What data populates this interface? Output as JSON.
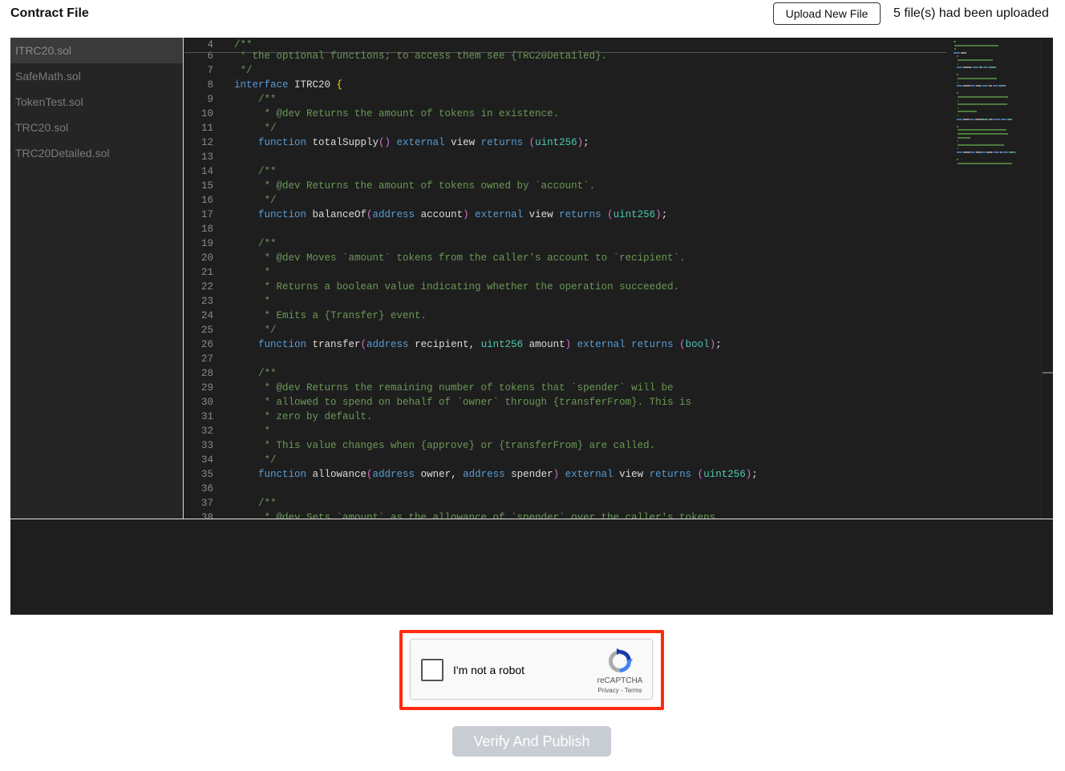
{
  "header": {
    "title": "Contract File",
    "upload_button": "Upload New File",
    "upload_status": "5 file(s) had been uploaded"
  },
  "files": [
    {
      "name": "ITRC20.sol",
      "active": true
    },
    {
      "name": "SafeMath.sol",
      "active": false
    },
    {
      "name": "TokenTest.sol",
      "active": false
    },
    {
      "name": "TRC20.sol",
      "active": false
    },
    {
      "name": "TRC20Detailed.sol",
      "active": false
    }
  ],
  "code": [
    {
      "n": "4",
      "t": [
        [
          "c-cm",
          "/**"
        ]
      ]
    },
    {
      "n": "6",
      "t": [
        [
          "c-cm",
          " * the optional functions; to access them see {TRC20Detailed}."
        ]
      ]
    },
    {
      "n": "7",
      "t": [
        [
          "c-cm",
          " */"
        ]
      ]
    },
    {
      "n": "8",
      "t": [
        [
          "c-kw",
          "interface"
        ],
        [
          "c-id",
          " ITRC20 "
        ],
        [
          "c-br",
          "{"
        ]
      ]
    },
    {
      "n": "9",
      "t": [
        [
          "c-cm",
          "    /**"
        ]
      ]
    },
    {
      "n": "10",
      "t": [
        [
          "c-cm",
          "     * @dev Returns the amount of tokens in existence."
        ]
      ]
    },
    {
      "n": "11",
      "t": [
        [
          "c-cm",
          "     */"
        ]
      ]
    },
    {
      "n": "12",
      "t": [
        [
          "c-kw",
          "    function"
        ],
        [
          "c-id",
          " totalSupply"
        ],
        [
          "c-pa",
          "()"
        ],
        [
          "c-kw",
          " external"
        ],
        [
          "c-id",
          " view"
        ],
        [
          "c-kw",
          " returns"
        ],
        [
          "c-pa",
          " ("
        ],
        [
          "c-ty",
          "uint256"
        ],
        [
          "c-pa",
          ")"
        ],
        [
          "c-id",
          ";"
        ]
      ]
    },
    {
      "n": "13",
      "t": []
    },
    {
      "n": "14",
      "t": [
        [
          "c-cm",
          "    /**"
        ]
      ]
    },
    {
      "n": "15",
      "t": [
        [
          "c-cm",
          "     * @dev Returns the amount of tokens owned by `account`."
        ]
      ]
    },
    {
      "n": "16",
      "t": [
        [
          "c-cm",
          "     */"
        ]
      ]
    },
    {
      "n": "17",
      "t": [
        [
          "c-kw",
          "    function"
        ],
        [
          "c-id",
          " balanceOf"
        ],
        [
          "c-pa",
          "("
        ],
        [
          "c-kw",
          "address"
        ],
        [
          "c-id",
          " account"
        ],
        [
          "c-pa",
          ")"
        ],
        [
          "c-kw",
          " external"
        ],
        [
          "c-id",
          " view"
        ],
        [
          "c-kw",
          " returns"
        ],
        [
          "c-pa",
          " ("
        ],
        [
          "c-ty",
          "uint256"
        ],
        [
          "c-pa",
          ")"
        ],
        [
          "c-id",
          ";"
        ]
      ]
    },
    {
      "n": "18",
      "t": []
    },
    {
      "n": "19",
      "t": [
        [
          "c-cm",
          "    /**"
        ]
      ]
    },
    {
      "n": "20",
      "t": [
        [
          "c-cm",
          "     * @dev Moves `amount` tokens from the caller's account to `recipient`."
        ]
      ]
    },
    {
      "n": "21",
      "t": [
        [
          "c-cm",
          "     *"
        ]
      ]
    },
    {
      "n": "22",
      "t": [
        [
          "c-cm",
          "     * Returns a boolean value indicating whether the operation succeeded."
        ]
      ]
    },
    {
      "n": "23",
      "t": [
        [
          "c-cm",
          "     *"
        ]
      ]
    },
    {
      "n": "24",
      "t": [
        [
          "c-cm",
          "     * Emits a {Transfer} event."
        ]
      ]
    },
    {
      "n": "25",
      "t": [
        [
          "c-cm",
          "     */"
        ]
      ]
    },
    {
      "n": "26",
      "t": [
        [
          "c-kw",
          "    function"
        ],
        [
          "c-id",
          " transfer"
        ],
        [
          "c-pa",
          "("
        ],
        [
          "c-kw",
          "address"
        ],
        [
          "c-id",
          " recipient, "
        ],
        [
          "c-ty",
          "uint256"
        ],
        [
          "c-id",
          " amount"
        ],
        [
          "c-pa",
          ")"
        ],
        [
          "c-kw",
          " external"
        ],
        [
          "c-kw",
          " returns"
        ],
        [
          "c-pa",
          " ("
        ],
        [
          "c-ty",
          "bool"
        ],
        [
          "c-pa",
          ")"
        ],
        [
          "c-id",
          ";"
        ]
      ]
    },
    {
      "n": "27",
      "t": []
    },
    {
      "n": "28",
      "t": [
        [
          "c-cm",
          "    /**"
        ]
      ]
    },
    {
      "n": "29",
      "t": [
        [
          "c-cm",
          "     * @dev Returns the remaining number of tokens that `spender` will be"
        ]
      ]
    },
    {
      "n": "30",
      "t": [
        [
          "c-cm",
          "     * allowed to spend on behalf of `owner` through {transferFrom}. This is"
        ]
      ]
    },
    {
      "n": "31",
      "t": [
        [
          "c-cm",
          "     * zero by default."
        ]
      ]
    },
    {
      "n": "32",
      "t": [
        [
          "c-cm",
          "     *"
        ]
      ]
    },
    {
      "n": "33",
      "t": [
        [
          "c-cm",
          "     * This value changes when {approve} or {transferFrom} are called."
        ]
      ]
    },
    {
      "n": "34",
      "t": [
        [
          "c-cm",
          "     */"
        ]
      ]
    },
    {
      "n": "35",
      "t": [
        [
          "c-kw",
          "    function"
        ],
        [
          "c-id",
          " allowance"
        ],
        [
          "c-pa",
          "("
        ],
        [
          "c-kw",
          "address"
        ],
        [
          "c-id",
          " owner, "
        ],
        [
          "c-kw",
          "address"
        ],
        [
          "c-id",
          " spender"
        ],
        [
          "c-pa",
          ")"
        ],
        [
          "c-kw",
          " external"
        ],
        [
          "c-id",
          " view"
        ],
        [
          "c-kw",
          " returns"
        ],
        [
          "c-pa",
          " ("
        ],
        [
          "c-ty",
          "uint256"
        ],
        [
          "c-pa",
          ")"
        ],
        [
          "c-id",
          ";"
        ]
      ]
    },
    {
      "n": "36",
      "t": []
    },
    {
      "n": "37",
      "t": [
        [
          "c-cm",
          "    /**"
        ]
      ]
    },
    {
      "n": "38",
      "t": [
        [
          "c-cm",
          "     * @dev Sets `amount` as the allowance of `spender` over the caller's tokens."
        ]
      ]
    }
  ],
  "captcha": {
    "label": "I'm not a robot",
    "brand": "reCAPTCHA",
    "links": "Privacy - Terms",
    "icon": "recaptcha-logo-icon"
  },
  "verify_button": "Verify And Publish",
  "colors": {
    "highlight": "#ff2a10",
    "editor_bg": "#1e1e1e",
    "button_disabled": "#c8cdd4"
  }
}
